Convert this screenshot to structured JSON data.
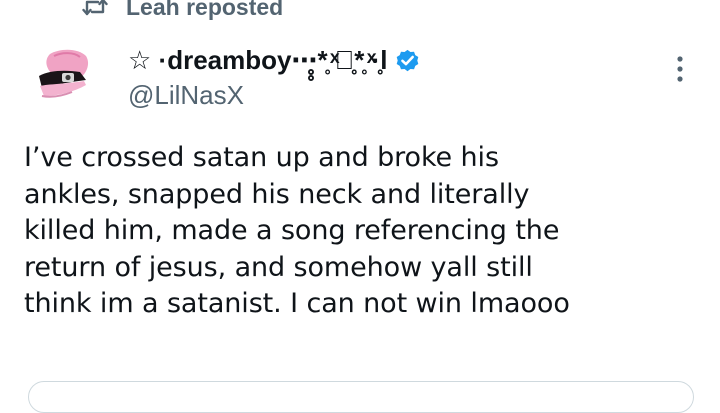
{
  "repost": {
    "label": "Leah reposted",
    "icon": "repost-icon"
  },
  "author": {
    "display_name": "☆ ·dreamboy⋯̥̥*̥ ͯ冬̥̥*̥ ͯ·̥̥l",
    "handle": "@LilNasX",
    "verified": true,
    "verified_color": "#1d9bf0",
    "avatar_icon": "avatar"
  },
  "menu": {
    "icon": "more-vertical-icon"
  },
  "tweet": {
    "text": "I’ve crossed satan up and broke his\nankles, snapped his neck and literally\nkilled him, made a song referencing the\nreturn of jesus, and somehow yall still\nthink im a satanist. I can not win lmaooo"
  },
  "colors": {
    "text_primary": "#0f1419",
    "text_secondary": "#536471",
    "border": "#cfd9de",
    "accent": "#1d9bf0"
  }
}
